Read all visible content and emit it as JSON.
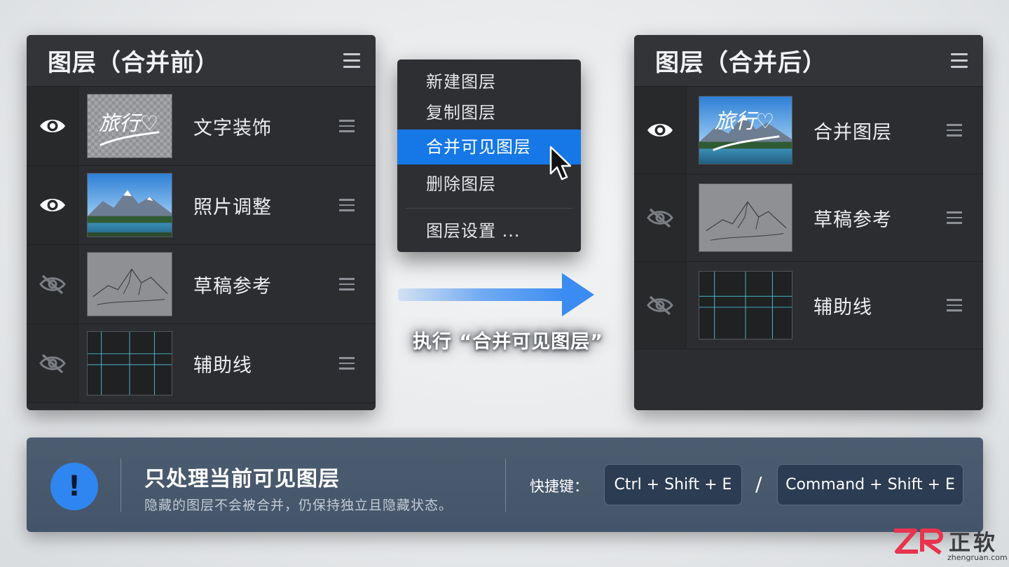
{
  "panel_before": {
    "title": "图层（合并前）",
    "layers": [
      {
        "name": "文字装饰",
        "visible": true,
        "thumb": "travel-text-thumbnail",
        "thumb_text": "旅行♡"
      },
      {
        "name": "照片调整",
        "visible": true,
        "thumb": "mountain-lake-photo-thumbnail"
      },
      {
        "name": "草稿参考",
        "visible": false,
        "thumb": "mountain-sketch-thumbnail"
      },
      {
        "name": "辅助线",
        "visible": false,
        "thumb": "grid-guides-thumbnail"
      }
    ]
  },
  "context_menu": {
    "items": [
      "新建图层",
      "复制图层",
      "合并可见图层",
      "删除图层"
    ],
    "active_item": "合并可见图层",
    "settings_item": "图层设置 ..."
  },
  "arrow_caption": "执行 “合并可见图层”",
  "panel_after": {
    "title": "图层（合并后）",
    "layers": [
      {
        "name": "合并图层",
        "visible": true,
        "thumb": "merged-photo-with-text-thumbnail",
        "thumb_text": "旅行♡"
      },
      {
        "name": "草稿参考",
        "visible": false,
        "thumb": "mountain-sketch-thumbnail"
      },
      {
        "name": "辅助线",
        "visible": false,
        "thumb": "grid-guides-thumbnail"
      }
    ]
  },
  "notice": {
    "title": "只处理当前可见图层",
    "description": "隐藏的图层不会被合并，仍保持独立且隐藏状态。",
    "shortcut_label": "快捷键：",
    "shortcut_windows": "Ctrl  +  Shift + E",
    "separator": "/",
    "shortcut_mac": "Command + Shift + E",
    "icon_glyph": "!"
  },
  "watermark": {
    "name": "正软",
    "domain": "zhengruan.com"
  },
  "colors": {
    "panel_bg": "#2b2d30",
    "menu_highlight": "#1677e6",
    "arrow": "#3b8cf2",
    "notice_bg": "#4a5a6e",
    "info_icon": "#2f86f0"
  },
  "icons": [
    "menu-icon",
    "eye-icon",
    "eye-off-icon",
    "drag-handle-icon",
    "mouse-cursor-icon",
    "right-arrow-icon",
    "info-icon"
  ]
}
